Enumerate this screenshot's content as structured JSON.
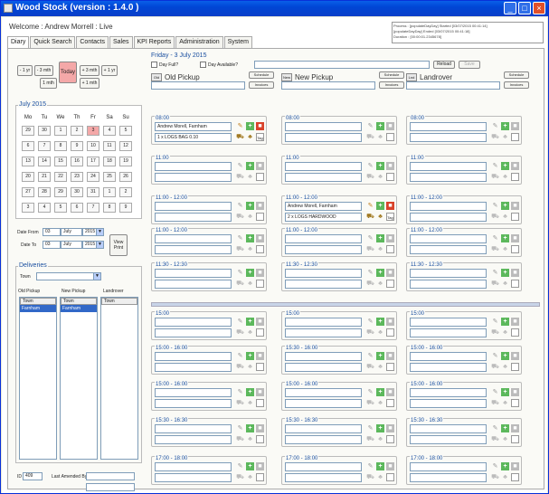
{
  "window": {
    "title": "Wood Stock (version : 1.4.0 )"
  },
  "welcome": "Welcome : Andrew Morrell : Live",
  "process": [
    "Process : [populateDayDay] Started [03/07/2015 00:41:14]",
    "[populateDayDay] Ended [03/07/2015 00:41:18]",
    "Duration : [00:00:01.2345678]"
  ],
  "tabs": [
    "Diary",
    "Quick Search",
    "Contacts",
    "Sales",
    "KPI Reports",
    "Administration",
    "System"
  ],
  "nav": {
    "minus1y": "- 1 yr",
    "minus3m": "- 3 mth",
    "plus3m": "+ 3 mth",
    "plus1y": "+ 1 yr",
    "minus1m": "1 mth",
    "plus1m": "+ 1 mth",
    "today": "Today"
  },
  "calendar": {
    "caption": "July 2015",
    "dow": [
      "Mo",
      "Tu",
      "We",
      "Th",
      "Fr",
      "Sa",
      "Su"
    ],
    "weeks": [
      [
        "29",
        "30",
        "1",
        "2",
        "3",
        "4",
        "5"
      ],
      [
        "6",
        "7",
        "8",
        "9",
        "10",
        "11",
        "12"
      ],
      [
        "13",
        "14",
        "15",
        "16",
        "17",
        "18",
        "19"
      ],
      [
        "20",
        "21",
        "22",
        "23",
        "24",
        "25",
        "26"
      ],
      [
        "27",
        "28",
        "29",
        "30",
        "31",
        "1",
        "2"
      ],
      [
        "3",
        "4",
        "5",
        "6",
        "7",
        "8",
        "9"
      ]
    ],
    "today_index": [
      0,
      4
    ]
  },
  "dates": {
    "from_label": "Date From",
    "to_label": "Date To",
    "day": "03",
    "month": "July",
    "year": "2015",
    "view_print": "View Print"
  },
  "deliveries": {
    "caption": "Deliveries",
    "town_label": "Town",
    "cols": [
      "Old Pickup",
      "New Pickup",
      "Landrover"
    ],
    "list_header": "Town",
    "rows": [
      "Farnham",
      "Farnham",
      ""
    ]
  },
  "footer": {
    "id_label": "ID",
    "id_value": "409",
    "last_amended": "Last Amended By"
  },
  "day": {
    "header": "Friday - 3 July 2015",
    "day_full": "Day Full?",
    "day_available": "Day Available?",
    "reload": "Reload",
    "save": "Save"
  },
  "columns": [
    {
      "name": "Old Pickup",
      "icon": "Old",
      "schedule": "Schedule",
      "invoices": "Invoices"
    },
    {
      "name": "New Pickup",
      "icon": "New",
      "schedule": "Schedule",
      "invoices": "Invoices"
    },
    {
      "name": "Landrover",
      "icon": "Lnd",
      "schedule": "Schedule",
      "invoices": "Invoices"
    }
  ],
  "am_slots": [
    [
      "08:00",
      "08:00",
      "08:00"
    ],
    [
      "11:00",
      "11:00",
      "11:00"
    ],
    [
      "11:00 - 12:00",
      "11:00 - 12:00",
      "11:00 - 12:00"
    ],
    [
      "11:00 - 12:00",
      "11:00 - 12:00",
      "11:00 - 12:00"
    ],
    [
      "11:30 - 12:30",
      "11:30 - 12:30",
      "11:30 - 12:30"
    ]
  ],
  "pm_slots": [
    [
      "15:00",
      "15:00",
      "15:00"
    ],
    [
      "15:00 - 16:00",
      "15:30 - 16:00",
      "15:00 - 16:00"
    ],
    [
      "15:00 - 16:00",
      "15:00 - 16:00",
      "15:00 - 16:00"
    ],
    [
      "15:30 - 16:30",
      "15:30 - 16:30",
      "15:30 - 16:30"
    ],
    [
      "17:00 - 18:00",
      "17:00 - 18:00",
      "17:00 - 18:00"
    ]
  ],
  "bookings": {
    "old_0800_customer": "Andrew Morell, Farnham",
    "old_0800_items": "1 x LOGS BAG 0.10",
    "new_1100_customer": "Andrew Morell, Farnham",
    "new_1100_items": "2 x LOGS HARDWOOD"
  },
  "tag": "Tag"
}
